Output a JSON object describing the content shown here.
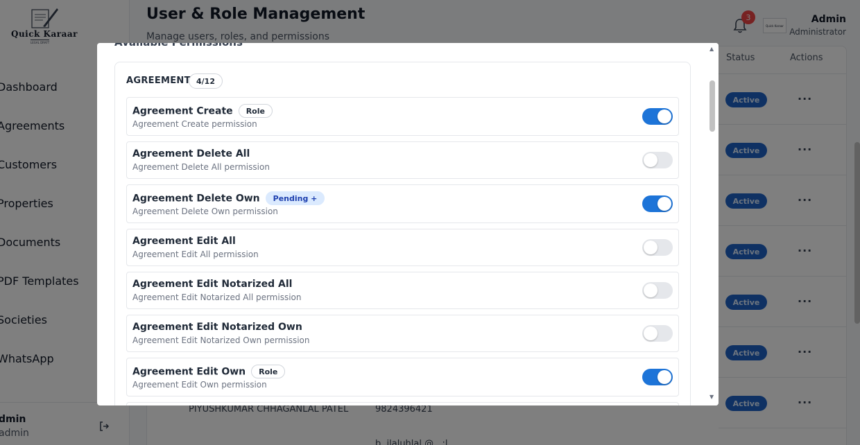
{
  "app": {
    "logo_text": "Quick Karaar",
    "logo_sub": "LEGAL DRAFT"
  },
  "sidebar": {
    "items": [
      {
        "label": "Dashboard"
      },
      {
        "label": "Agreements"
      },
      {
        "label": "Customers"
      },
      {
        "label": "Properties"
      },
      {
        "label": "Documents"
      },
      {
        "label": "PDF Templates"
      },
      {
        "label": "Societies"
      },
      {
        "label": "WhatsApp"
      }
    ],
    "user_name": "dmin",
    "user_role": "admin"
  },
  "header": {
    "title": "User & Role Management",
    "subtitle": "Manage users, roles, and permissions",
    "notification_count": "3",
    "user_name": "Admin",
    "user_role": "Administrator",
    "avatar_text": "Quick Karaar"
  },
  "table": {
    "col_status": "Status",
    "col_actions": "Actions",
    "status_label": "Active",
    "actions_label": "···",
    "partial_row_name": "PIYUSHKUMAR CHHAGANLAL PATEL",
    "partial_row_phone": "9824396421",
    "partial_row_email": "b..ilaluhlal.@...:l"
  },
  "modal": {
    "heading": "Available Permissions",
    "group_title": "AGREEMENT",
    "group_count": "4/12",
    "permissions": [
      {
        "name": "Agreement Create",
        "desc": "Agreement Create permission",
        "tag": "Role",
        "enabled": true
      },
      {
        "name": "Agreement Delete All",
        "desc": "Agreement Delete All permission",
        "tag": "",
        "enabled": false
      },
      {
        "name": "Agreement Delete Own",
        "desc": "Agreement Delete Own permission",
        "tag": "Pending +",
        "enabled": true
      },
      {
        "name": "Agreement Edit All",
        "desc": "Agreement Edit All permission",
        "tag": "",
        "enabled": false
      },
      {
        "name": "Agreement Edit Notarized All",
        "desc": "Agreement Edit Notarized All permission",
        "tag": "",
        "enabled": false
      },
      {
        "name": "Agreement Edit Notarized Own",
        "desc": "Agreement Edit Notarized Own permission",
        "tag": "",
        "enabled": false
      },
      {
        "name": "Agreement Edit Own",
        "desc": "Agreement Edit Own permission",
        "tag": "Role",
        "enabled": true
      }
    ]
  },
  "colors": {
    "accent": "#1d74d8",
    "status_badge": "#1e63c7",
    "notification": "#ef4444",
    "pending_tag_bg": "#dbeafe"
  }
}
